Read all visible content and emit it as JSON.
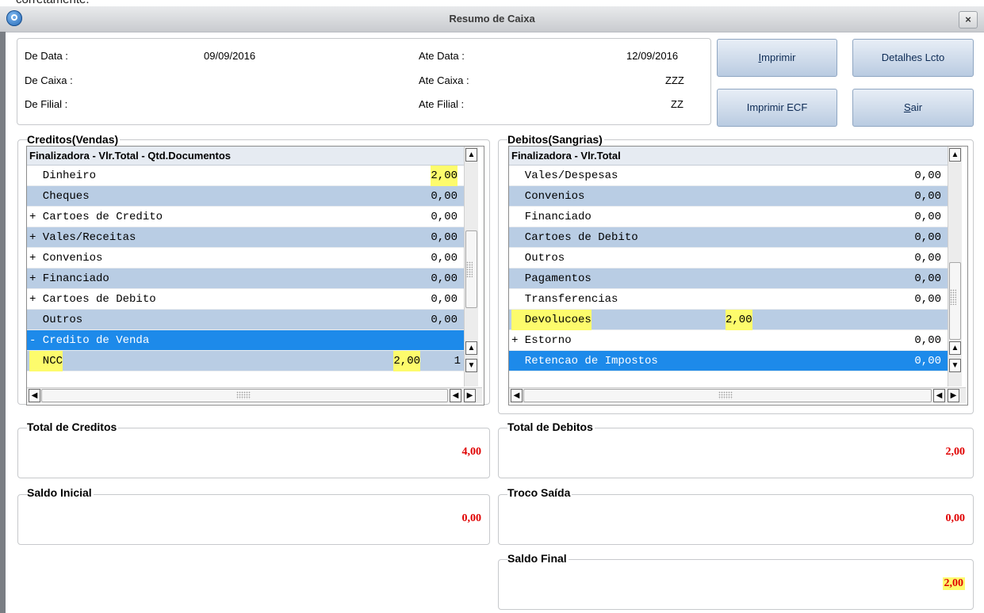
{
  "page_fragment": "corretamente.",
  "window": {
    "title": "Resumo de Caixa",
    "close_label": "×"
  },
  "filters": {
    "de_data_label": "De Data  :",
    "de_data_value": "09/09/2016",
    "ate_data_label": "Ate Data  :",
    "ate_data_value": "12/09/2016",
    "de_caixa_label": "De Caixa  :",
    "de_caixa_value": "",
    "ate_caixa_label": "Ate Caixa  :",
    "ate_caixa_value": "ZZZ",
    "de_filial_label": "De Filial :",
    "de_filial_value": "",
    "ate_filial_label": "Ate Filial :",
    "ate_filial_value": "ZZ"
  },
  "buttons": {
    "imprimir": {
      "underline": "I",
      "rest": "mprimir"
    },
    "detalhes": "Detalhes Lcto",
    "imprimir_ecf": "Imprimir ECF",
    "sair": {
      "underline": "S",
      "rest": "air"
    }
  },
  "creditos": {
    "title": "Creditos(Vendas)",
    "header": "Finalizadora - Vlr.Total - Qtd.Documentos",
    "rows": [
      {
        "name": "  Dinheiro",
        "value": "2,00",
        "qty": "",
        "style": "white",
        "highlight": true
      },
      {
        "name": "  Cheques",
        "value": "0,00",
        "qty": "",
        "style": "alt"
      },
      {
        "name": "+ Cartoes de Credito",
        "value": "0,00",
        "qty": "",
        "style": "white"
      },
      {
        "name": "+ Vales/Receitas",
        "value": "0,00",
        "qty": "",
        "style": "alt"
      },
      {
        "name": "+ Convenios",
        "value": "0,00",
        "qty": "",
        "style": "white"
      },
      {
        "name": "+ Financiado",
        "value": "0,00",
        "qty": "",
        "style": "alt"
      },
      {
        "name": "+ Cartoes de Debito",
        "value": "0,00",
        "qty": "",
        "style": "white"
      },
      {
        "name": "  Outros",
        "value": "0,00",
        "qty": "",
        "style": "alt"
      },
      {
        "name": "- Credito de Venda",
        "value": "",
        "qty": "",
        "style": "sel"
      },
      {
        "name": "  NCC",
        "value": "2,00",
        "qty": "1",
        "style": "alt",
        "highlight": true,
        "highlight_name": true
      }
    ]
  },
  "debitos": {
    "title": "Debitos(Sangrias)",
    "header": "Finalizadora - Vlr.Total",
    "rows": [
      {
        "name": "  Vales/Despesas",
        "value": "0,00",
        "style": "white"
      },
      {
        "name": "  Convenios",
        "value": "0,00",
        "style": "alt"
      },
      {
        "name": "  Financiado",
        "value": "0,00",
        "style": "white"
      },
      {
        "name": "  Cartoes de Debito",
        "value": "0,00",
        "style": "alt"
      },
      {
        "name": "  Outros",
        "value": "0,00",
        "style": "white"
      },
      {
        "name": "  Pagamentos",
        "value": "0,00",
        "style": "alt"
      },
      {
        "name": "  Transferencias",
        "value": "0,00",
        "style": "white"
      },
      {
        "name": "  Devolucoes",
        "value": "2,00",
        "style": "alt",
        "highlight": true,
        "highlight_name": true,
        "mid": true
      },
      {
        "name": "+ Estorno",
        "value": "0,00",
        "style": "white"
      },
      {
        "name": "  Retencao de Impostos",
        "value": "0,00",
        "style": "sel"
      }
    ]
  },
  "totals": {
    "total_creditos": {
      "label": "Total de Creditos",
      "value": "4,00"
    },
    "total_debitos": {
      "label": "Total de Debitos",
      "value": "2,00"
    },
    "saldo_inicial": {
      "label": "Saldo Inicial",
      "value": "0,00"
    },
    "troco_saida": {
      "label": "Troco Saída",
      "value": "0,00"
    },
    "saldo_final": {
      "label": "Saldo Final",
      "value": "2,00"
    }
  }
}
